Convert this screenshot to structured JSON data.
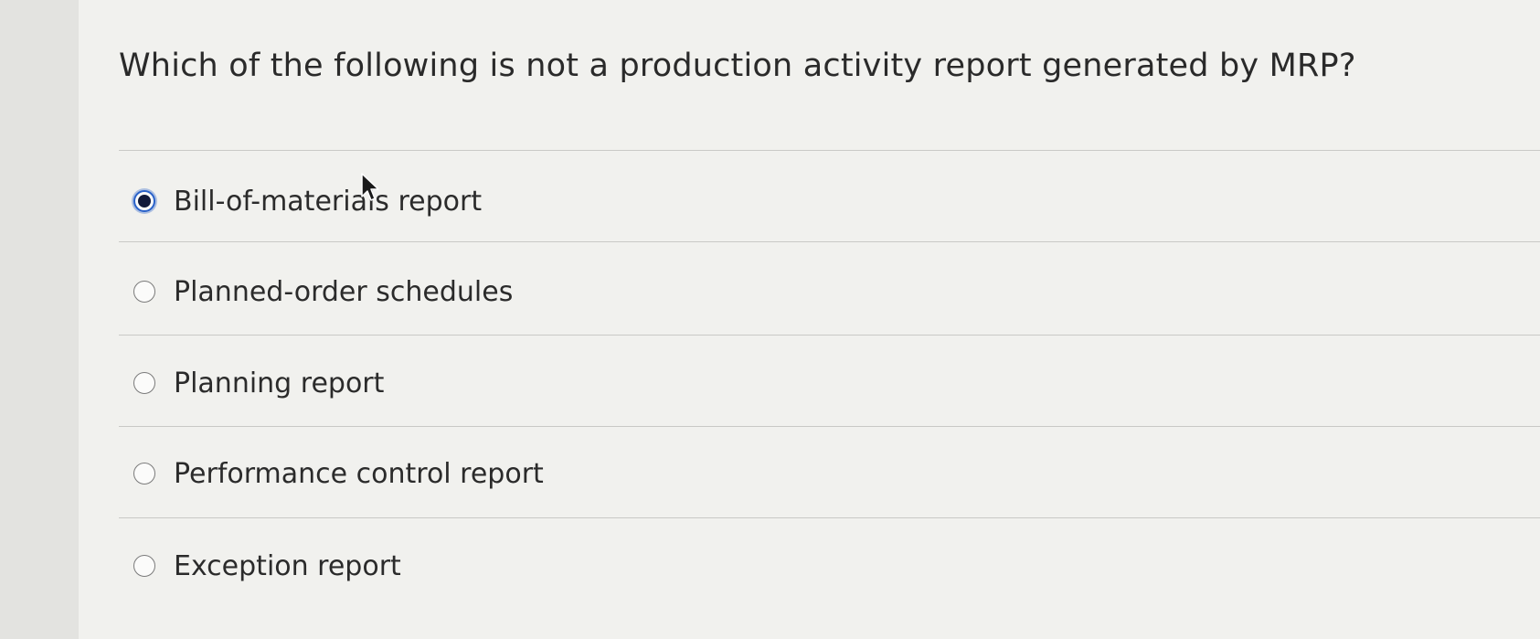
{
  "question": {
    "text": "Which of the following is not a production activity report generated by MRP?"
  },
  "options": [
    {
      "label": "Bill-of-materials report",
      "selected": true
    },
    {
      "label": "Planned-order schedules",
      "selected": false
    },
    {
      "label": "Planning report",
      "selected": false
    },
    {
      "label": "Performance control report",
      "selected": false
    },
    {
      "label": "Exception report",
      "selected": false
    }
  ],
  "colors": {
    "selected_radio_ring": "#2a62c9",
    "selected_radio_dot": "#10193a"
  },
  "icons": {
    "cursor": "mouse-pointer-icon"
  }
}
